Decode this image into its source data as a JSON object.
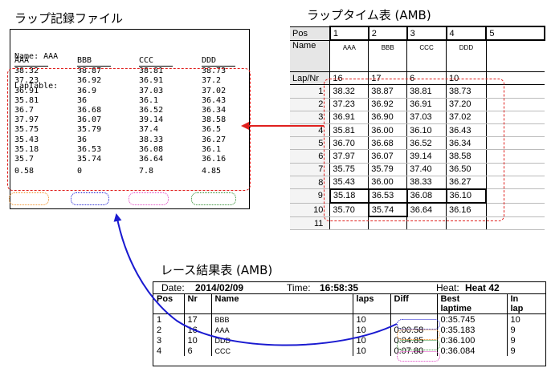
{
  "file_panel": {
    "title": "ラップ記録ファイル",
    "header_lines": [
      "Name: AAA",
      "LapTable:"
    ],
    "columns": [
      {
        "name": "AAA",
        "laps": [
          "38.32",
          "37.23",
          "36.91",
          "35.81",
          "36.7",
          "37.97",
          "35.75",
          "35.43",
          "35.18",
          "35.7"
        ],
        "diff": "0.58"
      },
      {
        "name": "BBB",
        "laps": [
          "38.87",
          "36.92",
          "36.9",
          "36",
          "36.68",
          "36.07",
          "35.79",
          "36",
          "36.53",
          "35.74"
        ],
        "diff": "0"
      },
      {
        "name": "CCC",
        "laps": [
          "38.81",
          "36.91",
          "37.03",
          "36.1",
          "36.52",
          "39.14",
          "37.4",
          "38.33",
          "36.08",
          "36.64"
        ],
        "diff": "7.8"
      },
      {
        "name": "DDD",
        "laps": [
          "38.73",
          "37.2",
          "37.02",
          "36.43",
          "36.34",
          "38.58",
          "36.5",
          "36.27",
          "36.1",
          "36.16"
        ],
        "diff": "4.85"
      }
    ]
  },
  "lap_panel": {
    "title": "ラップタイム表 (AMB)",
    "pos_label": "Pos",
    "positions": [
      "1",
      "2",
      "3",
      "4",
      "5"
    ],
    "name_label": "Name",
    "names": [
      "AAA",
      "BBB",
      "CCC",
      "DDD"
    ],
    "lapnr_label": "Lap/Nr",
    "nrs": [
      "16",
      "17",
      "6",
      "10"
    ],
    "rows": [
      {
        "lap": "1",
        "v": [
          "38.32",
          "38.87",
          "38.81",
          "38.73"
        ]
      },
      {
        "lap": "2",
        "v": [
          "37.23",
          "36.92",
          "36.91",
          "37.20"
        ]
      },
      {
        "lap": "3",
        "v": [
          "36.91",
          "36.90",
          "37.03",
          "37.02"
        ]
      },
      {
        "lap": "4",
        "v": [
          "35.81",
          "36.00",
          "36.10",
          "36.43"
        ]
      },
      {
        "lap": "5",
        "v": [
          "36.70",
          "36.68",
          "36.52",
          "36.34"
        ]
      },
      {
        "lap": "6",
        "v": [
          "37.97",
          "36.07",
          "39.14",
          "38.58"
        ]
      },
      {
        "lap": "7",
        "v": [
          "35.75",
          "35.79",
          "37.40",
          "36.50"
        ]
      },
      {
        "lap": "8",
        "v": [
          "35.43",
          "36.00",
          "38.33",
          "36.27"
        ]
      },
      {
        "lap": "9",
        "v": [
          "35.18",
          "36.53",
          "36.08",
          "36.10"
        ]
      },
      {
        "lap": "10",
        "v": [
          "35.70",
          "35.74",
          "36.64",
          "36.16"
        ]
      },
      {
        "lap": "11",
        "v": [
          "",
          "",
          "",
          ""
        ]
      }
    ]
  },
  "results_panel": {
    "title": "レース結果表 (AMB)",
    "date_label": "Date:",
    "date": "2014/02/09",
    "time_label": "Time:",
    "time": "16:58:35",
    "heat_label": "Heat:",
    "heat": "Heat 42",
    "headers": {
      "pos": "Pos",
      "nr": "Nr",
      "name": "Name",
      "laps": "laps",
      "diff": "Diff",
      "best1": "Best",
      "best2": "laptime",
      "in1": "In",
      "in2": "lap"
    },
    "rows": [
      {
        "pos": "1",
        "nr": "17",
        "name": "BBB",
        "laps": "10",
        "diff": "",
        "best": "0:35.745",
        "in": "10"
      },
      {
        "pos": "2",
        "nr": "16",
        "name": "AAA",
        "laps": "10",
        "diff": "0:00.58",
        "best": "0:35.183",
        "in": "9"
      },
      {
        "pos": "3",
        "nr": "10",
        "name": "DDD",
        "laps": "10",
        "diff": "0:04.85",
        "best": "0:36.100",
        "in": "9"
      },
      {
        "pos": "4",
        "nr": "6",
        "name": "CCC",
        "laps": "10",
        "diff": "0:07.80",
        "best": "0:36.084",
        "in": "9"
      }
    ]
  },
  "colors": {
    "red": "#e0201e",
    "blue": "#1a1ad0",
    "orange": "#f08a1c",
    "magenta": "#e040c0",
    "green": "#2a8a2a"
  }
}
